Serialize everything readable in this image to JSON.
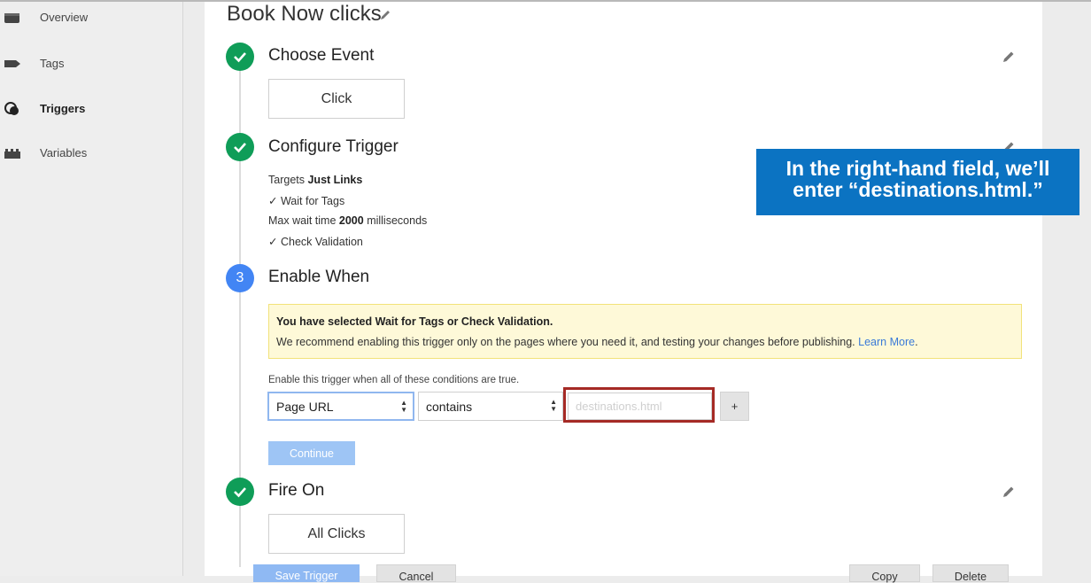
{
  "sidebar": {
    "items": [
      {
        "label": "Overview",
        "icon": "overview-icon"
      },
      {
        "label": "Tags",
        "icon": "tag-icon"
      },
      {
        "label": "Triggers",
        "icon": "trigger-icon",
        "active": true
      },
      {
        "label": "Variables",
        "icon": "variables-icon"
      }
    ]
  },
  "trigger": {
    "title": "Book Now clicks"
  },
  "steps": {
    "choose_event": {
      "title": "Choose Event",
      "value": "Click"
    },
    "configure": {
      "title": "Configure Trigger",
      "targets_prefix": "Targets",
      "targets_value": "Just Links",
      "wait_for_tags": "Wait for Tags",
      "max_wait_prefix": "Max wait time",
      "max_wait_value": "2000",
      "max_wait_suffix": "milliseconds",
      "check_validation": "Check Validation",
      "check_mark": "✓"
    },
    "enable_when": {
      "number": "3",
      "title": "Enable When",
      "warning_title": "You have selected Wait for Tags or Check Validation.",
      "warning_text": "We recommend enabling this trigger only on the pages where you need it, and testing your changes before publishing.",
      "warning_link": "Learn More",
      "warning_period": ".",
      "conditions_label": "Enable this trigger when all of these conditions are true.",
      "variable_select": "Page URL",
      "operator_select": "contains",
      "value_placeholder": "destinations.html",
      "add_button": "+",
      "continue_button": "Continue"
    },
    "fire_on": {
      "title": "Fire On",
      "value": "All Clicks"
    }
  },
  "footer": {
    "save": "Save Trigger",
    "cancel": "Cancel",
    "copy": "Copy",
    "delete": "Delete"
  },
  "callout": {
    "line1": "In the right-hand field, we’ll",
    "line2": "enter “destinations.html.”"
  },
  "colors": {
    "success": "#0f9d58",
    "active_step": "#4285f4",
    "callout": "#0b73c2",
    "highlight_border": "#a52a25",
    "link": "#3a7ad8"
  }
}
